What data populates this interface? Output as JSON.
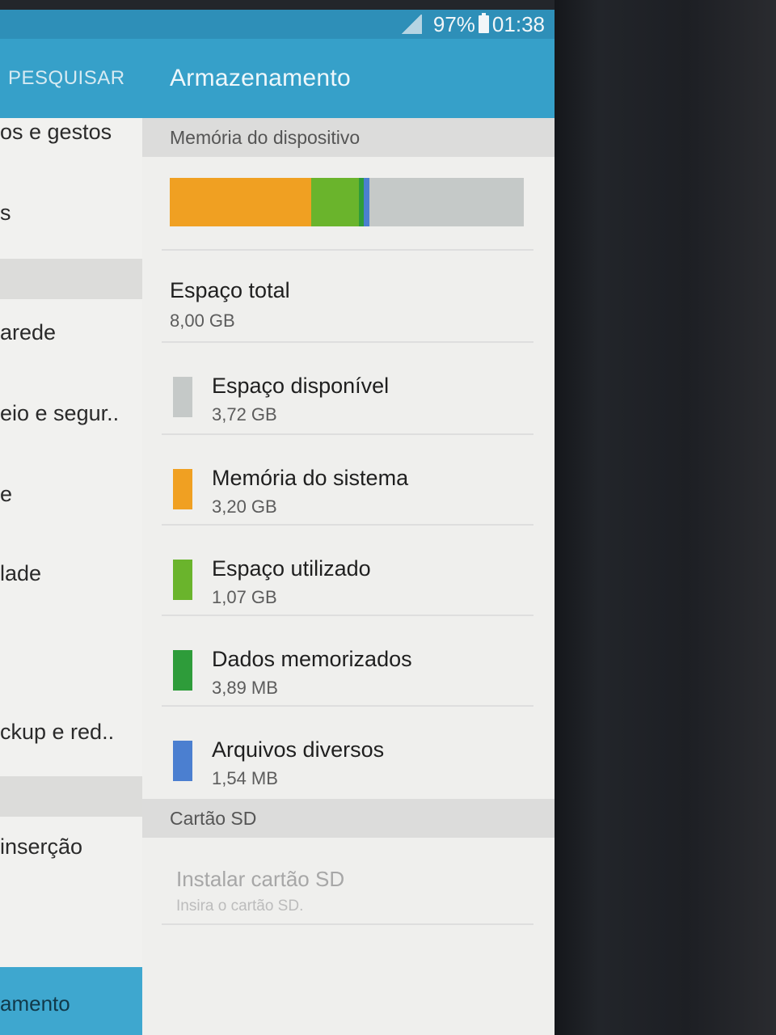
{
  "status_bar": {
    "battery": "97%",
    "time": "01:38"
  },
  "left_panel": {
    "search_label": "PESQUISAR",
    "items": [
      "os e gestos",
      "s",
      "arede",
      "eio e segur..",
      "e",
      "lade",
      "ckup e red..",
      "inserção",
      "amento"
    ]
  },
  "header": {
    "title": "Armazenamento"
  },
  "device_memory": {
    "section_title": "Memória do dispositivo",
    "total_label": "Espaço total",
    "total_value": "8,00 GB",
    "usage_bar": [
      {
        "name": "Memória do sistema",
        "fraction": 0.4,
        "color": "#f0a022"
      },
      {
        "name": "Espaço utilizado",
        "fraction": 0.135,
        "color": "#6ab42c"
      },
      {
        "name": "Dados memorizados",
        "fraction": 0.012,
        "color": "#2e9c3a"
      },
      {
        "name": "Arquivos diversos",
        "fraction": 0.018,
        "color": "#4b7fd0"
      }
    ],
    "bar_free_color": "#c5c9c8",
    "items": [
      {
        "label": "Espaço disponível",
        "value": "3,72 GB",
        "color": "#c5c9c8"
      },
      {
        "label": "Memória do sistema",
        "value": "3,20 GB",
        "color": "#f0a022"
      },
      {
        "label": "Espaço utilizado",
        "value": "1,07 GB",
        "color": "#6ab42c"
      },
      {
        "label": "Dados memorizados",
        "value": "3,89 MB",
        "color": "#2e9c3a"
      },
      {
        "label": "Arquivos diversos",
        "value": "1,54 MB",
        "color": "#4b7fd0"
      }
    ]
  },
  "sd_card": {
    "section_title": "Cartão SD",
    "install_label": "Instalar cartão SD",
    "install_sub": "Insira o cartão SD."
  },
  "colors": {
    "accent": "#36a0c9",
    "status_bar": "#2e8fb8"
  }
}
